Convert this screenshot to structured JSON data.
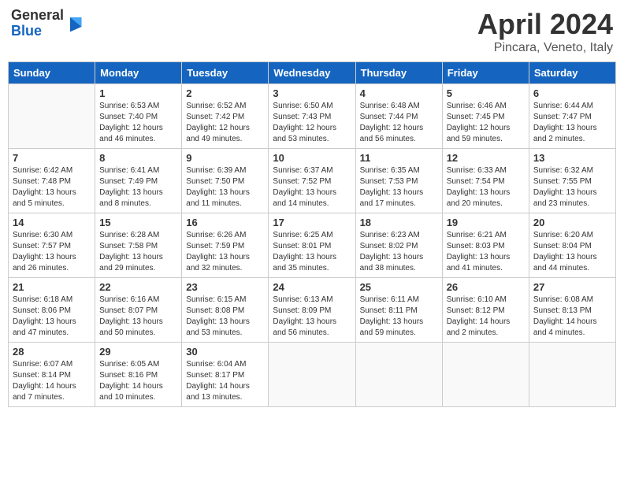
{
  "header": {
    "logo_general": "General",
    "logo_blue": "Blue",
    "month_title": "April 2024",
    "location": "Pincara, Veneto, Italy"
  },
  "weekdays": [
    "Sunday",
    "Monday",
    "Tuesday",
    "Wednesday",
    "Thursday",
    "Friday",
    "Saturday"
  ],
  "weeks": [
    [
      {
        "day": "",
        "info": ""
      },
      {
        "day": "1",
        "info": "Sunrise: 6:53 AM\nSunset: 7:40 PM\nDaylight: 12 hours\nand 46 minutes."
      },
      {
        "day": "2",
        "info": "Sunrise: 6:52 AM\nSunset: 7:42 PM\nDaylight: 12 hours\nand 49 minutes."
      },
      {
        "day": "3",
        "info": "Sunrise: 6:50 AM\nSunset: 7:43 PM\nDaylight: 12 hours\nand 53 minutes."
      },
      {
        "day": "4",
        "info": "Sunrise: 6:48 AM\nSunset: 7:44 PM\nDaylight: 12 hours\nand 56 minutes."
      },
      {
        "day": "5",
        "info": "Sunrise: 6:46 AM\nSunset: 7:45 PM\nDaylight: 12 hours\nand 59 minutes."
      },
      {
        "day": "6",
        "info": "Sunrise: 6:44 AM\nSunset: 7:47 PM\nDaylight: 13 hours\nand 2 minutes."
      }
    ],
    [
      {
        "day": "7",
        "info": "Sunrise: 6:42 AM\nSunset: 7:48 PM\nDaylight: 13 hours\nand 5 minutes."
      },
      {
        "day": "8",
        "info": "Sunrise: 6:41 AM\nSunset: 7:49 PM\nDaylight: 13 hours\nand 8 minutes."
      },
      {
        "day": "9",
        "info": "Sunrise: 6:39 AM\nSunset: 7:50 PM\nDaylight: 13 hours\nand 11 minutes."
      },
      {
        "day": "10",
        "info": "Sunrise: 6:37 AM\nSunset: 7:52 PM\nDaylight: 13 hours\nand 14 minutes."
      },
      {
        "day": "11",
        "info": "Sunrise: 6:35 AM\nSunset: 7:53 PM\nDaylight: 13 hours\nand 17 minutes."
      },
      {
        "day": "12",
        "info": "Sunrise: 6:33 AM\nSunset: 7:54 PM\nDaylight: 13 hours\nand 20 minutes."
      },
      {
        "day": "13",
        "info": "Sunrise: 6:32 AM\nSunset: 7:55 PM\nDaylight: 13 hours\nand 23 minutes."
      }
    ],
    [
      {
        "day": "14",
        "info": "Sunrise: 6:30 AM\nSunset: 7:57 PM\nDaylight: 13 hours\nand 26 minutes."
      },
      {
        "day": "15",
        "info": "Sunrise: 6:28 AM\nSunset: 7:58 PM\nDaylight: 13 hours\nand 29 minutes."
      },
      {
        "day": "16",
        "info": "Sunrise: 6:26 AM\nSunset: 7:59 PM\nDaylight: 13 hours\nand 32 minutes."
      },
      {
        "day": "17",
        "info": "Sunrise: 6:25 AM\nSunset: 8:01 PM\nDaylight: 13 hours\nand 35 minutes."
      },
      {
        "day": "18",
        "info": "Sunrise: 6:23 AM\nSunset: 8:02 PM\nDaylight: 13 hours\nand 38 minutes."
      },
      {
        "day": "19",
        "info": "Sunrise: 6:21 AM\nSunset: 8:03 PM\nDaylight: 13 hours\nand 41 minutes."
      },
      {
        "day": "20",
        "info": "Sunrise: 6:20 AM\nSunset: 8:04 PM\nDaylight: 13 hours\nand 44 minutes."
      }
    ],
    [
      {
        "day": "21",
        "info": "Sunrise: 6:18 AM\nSunset: 8:06 PM\nDaylight: 13 hours\nand 47 minutes."
      },
      {
        "day": "22",
        "info": "Sunrise: 6:16 AM\nSunset: 8:07 PM\nDaylight: 13 hours\nand 50 minutes."
      },
      {
        "day": "23",
        "info": "Sunrise: 6:15 AM\nSunset: 8:08 PM\nDaylight: 13 hours\nand 53 minutes."
      },
      {
        "day": "24",
        "info": "Sunrise: 6:13 AM\nSunset: 8:09 PM\nDaylight: 13 hours\nand 56 minutes."
      },
      {
        "day": "25",
        "info": "Sunrise: 6:11 AM\nSunset: 8:11 PM\nDaylight: 13 hours\nand 59 minutes."
      },
      {
        "day": "26",
        "info": "Sunrise: 6:10 AM\nSunset: 8:12 PM\nDaylight: 14 hours\nand 2 minutes."
      },
      {
        "day": "27",
        "info": "Sunrise: 6:08 AM\nSunset: 8:13 PM\nDaylight: 14 hours\nand 4 minutes."
      }
    ],
    [
      {
        "day": "28",
        "info": "Sunrise: 6:07 AM\nSunset: 8:14 PM\nDaylight: 14 hours\nand 7 minutes."
      },
      {
        "day": "29",
        "info": "Sunrise: 6:05 AM\nSunset: 8:16 PM\nDaylight: 14 hours\nand 10 minutes."
      },
      {
        "day": "30",
        "info": "Sunrise: 6:04 AM\nSunset: 8:17 PM\nDaylight: 14 hours\nand 13 minutes."
      },
      {
        "day": "",
        "info": ""
      },
      {
        "day": "",
        "info": ""
      },
      {
        "day": "",
        "info": ""
      },
      {
        "day": "",
        "info": ""
      }
    ]
  ]
}
